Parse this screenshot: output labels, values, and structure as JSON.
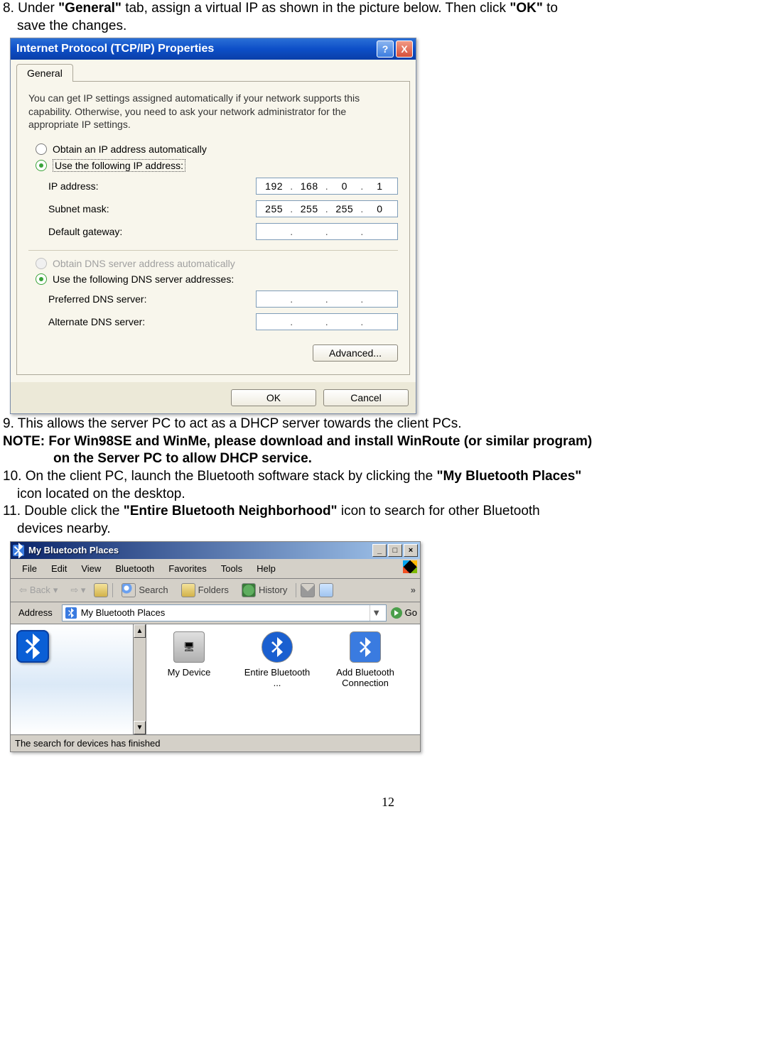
{
  "doc": {
    "step8": {
      "num": "8. Under ",
      "bold1": "\"General\"",
      "mid": " tab, assign a virtual IP as shown in the picture below. Then click ",
      "bold2": "\"OK\"",
      "end": " to",
      "line2": "save the changes."
    },
    "step9": "9. This allows the server PC to act as a DHCP server towards the client PCs.",
    "note1": "NOTE: For Win98SE and WinMe, please download and install WinRoute (or similar program)",
    "note2": "on the Server PC to allow DHCP service.",
    "step10": {
      "a": "10. On the client PC, launch the Bluetooth software stack by clicking the ",
      "bold": "\"My Bluetooth Places\"",
      "line2": "icon located on the desktop."
    },
    "step11": {
      "a": "11. Double click the ",
      "bold": "\"Entire Bluetooth Neighborhood\"",
      "b": " icon to search for other Bluetooth",
      "line2": "devices nearby."
    },
    "pagenum": "12"
  },
  "tcpip": {
    "title": "Internet Protocol (TCP/IP) Properties",
    "tab": "General",
    "desc": "You can get IP settings assigned automatically if your network supports this capability. Otherwise, you need to ask your network administrator for the appropriate IP settings.",
    "radio_auto_ip": "Obtain an IP address automatically",
    "radio_use_ip": "Use the following IP address:",
    "lbl_ip": "IP address:",
    "ip": {
      "a": "192",
      "b": "168",
      "c": "0",
      "d": "1"
    },
    "lbl_subnet": "Subnet mask:",
    "subnet": {
      "a": "255",
      "b": "255",
      "c": "255",
      "d": "0"
    },
    "lbl_gateway": "Default gateway:",
    "radio_auto_dns": "Obtain DNS server address automatically",
    "radio_use_dns": "Use the following DNS server addresses:",
    "lbl_pref_dns": "Preferred DNS server:",
    "lbl_alt_dns": "Alternate DNS server:",
    "btn_advanced": "Advanced...",
    "btn_ok": "OK",
    "btn_cancel": "Cancel",
    "help": "?",
    "close": "X"
  },
  "bt": {
    "title": "My Bluetooth Places",
    "menu": {
      "file": "File",
      "edit": "Edit",
      "view": "View",
      "bluetooth": "Bluetooth",
      "favorites": "Favorites",
      "tools": "Tools",
      "help": "Help"
    },
    "toolbar": {
      "back": "Back",
      "search": "Search",
      "folders": "Folders",
      "history": "History"
    },
    "address_label": "Address",
    "address_value": "My Bluetooth Places",
    "go": "Go",
    "items": {
      "mydevice": "My Device",
      "entire": "Entire Bluetooth ...",
      "addconn": "Add Bluetooth Connection"
    },
    "status": "The search for devices has finished",
    "min": "_",
    "max": "□",
    "close": "×",
    "up": "▲",
    "down": "▼",
    "chevrons": "»",
    "dropdown": "▼"
  }
}
